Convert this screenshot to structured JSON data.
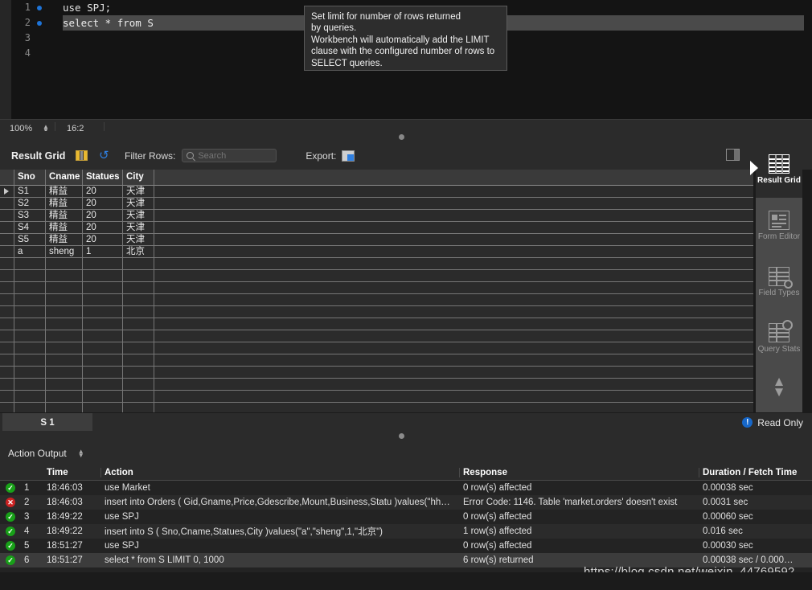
{
  "editor": {
    "lines": [
      {
        "num": "1",
        "text": "use SPJ;",
        "breakpoint": true,
        "active": false
      },
      {
        "num": "2",
        "text": "select * from S",
        "breakpoint": true,
        "active": true
      },
      {
        "num": "3",
        "text": "",
        "breakpoint": false,
        "active": false
      },
      {
        "num": "4",
        "text": "",
        "breakpoint": false,
        "active": false
      }
    ],
    "tooltip": "Set limit for number of rows returned\nby queries.\nWorkbench will automatically add the LIMIT\nclause with the configured number of rows to\nSELECT queries."
  },
  "statusbar": {
    "zoom": "100%",
    "position": "16:2",
    "stepper_up": "▲",
    "stepper_down": "▼"
  },
  "result_toolbar": {
    "title": "Result Grid",
    "grid_icon": "grid-view-icon",
    "refresh_icon": "refresh-icon",
    "filter_label": "Filter Rows:",
    "search_placeholder": "Search",
    "search_value": "",
    "export_label": "Export:",
    "export_icon": "export-recordset-icon",
    "wrap_toggle_icon": "panel-toggle-icon"
  },
  "grid": {
    "columns": [
      "Sno",
      "Cname",
      "Statues",
      "City"
    ],
    "rows": [
      {
        "selected": true,
        "cells": [
          "S1",
          "精益",
          "20",
          "天津"
        ]
      },
      {
        "selected": false,
        "cells": [
          "S2",
          "精益",
          "20",
          "天津"
        ]
      },
      {
        "selected": false,
        "cells": [
          "S3",
          "精益",
          "20",
          "天津"
        ]
      },
      {
        "selected": false,
        "cells": [
          "S4",
          "精益",
          "20",
          "天津"
        ]
      },
      {
        "selected": false,
        "cells": [
          "S5",
          "精益",
          "20",
          "天津"
        ]
      },
      {
        "selected": false,
        "cells": [
          "a",
          "sheng",
          "1",
          "北京"
        ]
      }
    ],
    "empty_row_count": 13
  },
  "sidebar": {
    "items": [
      {
        "label": "Result\nGrid",
        "icon": "result-grid-icon",
        "active": true
      },
      {
        "label": "Form\nEditor",
        "icon": "form-editor-icon",
        "active": false
      },
      {
        "label": "Field\nTypes",
        "icon": "field-types-icon",
        "active": false
      },
      {
        "label": "Query\nStats",
        "icon": "query-stats-icon",
        "active": false
      }
    ],
    "collapse_icon": "collapse-panel-arrow-icon",
    "chevron_up": "▲",
    "chevron_down": "▼"
  },
  "tabbar": {
    "tab_label": "S 1",
    "readonly_label": "Read Only",
    "readonly_icon": "info-icon",
    "readonly_icon_glyph": "!"
  },
  "action_output": {
    "panel_title": "Action Output",
    "columns": [
      "",
      "",
      "Time",
      "Action",
      "Response",
      "Duration / Fetch Time"
    ],
    "rows": [
      {
        "status": "ok",
        "num": "1",
        "time": "18:46:03",
        "action": "use Market",
        "response": "0 row(s) affected",
        "duration": "0.00038 sec"
      },
      {
        "status": "error",
        "num": "2",
        "time": "18:46:03",
        "action": "insert into Orders (  Gid,Gname,Price,Gdescribe,Mount,Business,Statu )values(\"hh…",
        "response": "Error Code: 1146. Table 'market.orders' doesn't exist",
        "duration": "0.0031 sec"
      },
      {
        "status": "ok",
        "num": "3",
        "time": "18:49:22",
        "action": "use SPJ",
        "response": "0 row(s) affected",
        "duration": "0.00060 sec"
      },
      {
        "status": "ok",
        "num": "4",
        "time": "18:49:22",
        "action": "insert into S (  Sno,Cname,Statues,City )values(\"a\",\"sheng\",1,\"北京\")",
        "response": "1 row(s) affected",
        "duration": "0.016 sec"
      },
      {
        "status": "ok",
        "num": "5",
        "time": "18:51:27",
        "action": "use SPJ",
        "response": "0 row(s) affected",
        "duration": "0.00030 sec"
      },
      {
        "status": "ok",
        "num": "6",
        "time": "18:51:27",
        "action": "select * from S LIMIT 0, 1000",
        "response": "6 row(s) returned",
        "duration": "0.00038 sec / 0.000…"
      }
    ],
    "status_ok_glyph": "✓",
    "status_err_glyph": "✕",
    "status_ok_color": "#18a018",
    "status_err_color": "#cc2222"
  },
  "watermark": "https://blog.csdn.net/weixin_44769592"
}
